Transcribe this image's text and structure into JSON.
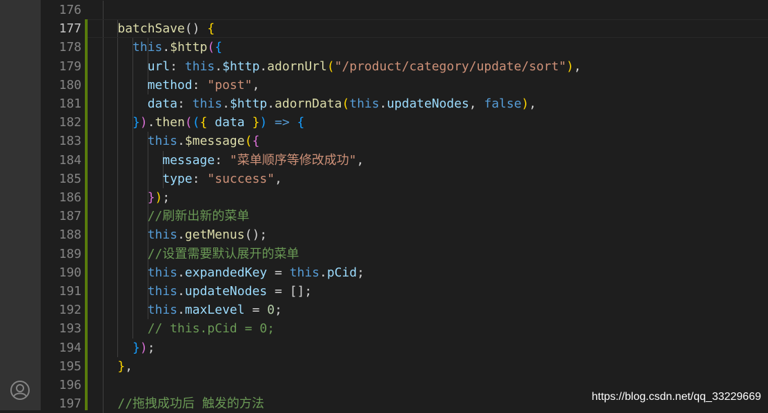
{
  "editor": {
    "lines": [
      {
        "num": "176",
        "segs": []
      },
      {
        "num": "177",
        "segs": [
          [
            "    ",
            "pu"
          ],
          [
            "batchSave",
            "f"
          ],
          [
            "() ",
            "pu"
          ],
          [
            "{",
            "bk"
          ]
        ]
      },
      {
        "num": "178",
        "segs": [
          [
            "      ",
            "pu"
          ],
          [
            "this",
            "k"
          ],
          [
            ".",
            "pu"
          ],
          [
            "$http",
            "f"
          ],
          [
            "(",
            "bk2"
          ],
          [
            "{",
            "bk3"
          ]
        ]
      },
      {
        "num": "179",
        "segs": [
          [
            "        ",
            "pu"
          ],
          [
            "url",
            "p"
          ],
          [
            ": ",
            "pu"
          ],
          [
            "this",
            "k"
          ],
          [
            ".",
            "pu"
          ],
          [
            "$http",
            "p"
          ],
          [
            ".",
            "pu"
          ],
          [
            "adornUrl",
            "f"
          ],
          [
            "(",
            "bk"
          ],
          [
            "\"/product/category/update/sort\"",
            "s"
          ],
          [
            ")",
            "bk"
          ],
          [
            ",",
            "pu"
          ]
        ]
      },
      {
        "num": "180",
        "segs": [
          [
            "        ",
            "pu"
          ],
          [
            "method",
            "p"
          ],
          [
            ": ",
            "pu"
          ],
          [
            "\"post\"",
            "s"
          ],
          [
            ",",
            "pu"
          ]
        ]
      },
      {
        "num": "181",
        "segs": [
          [
            "        ",
            "pu"
          ],
          [
            "data",
            "p"
          ],
          [
            ": ",
            "pu"
          ],
          [
            "this",
            "k"
          ],
          [
            ".",
            "pu"
          ],
          [
            "$http",
            "p"
          ],
          [
            ".",
            "pu"
          ],
          [
            "adornData",
            "f"
          ],
          [
            "(",
            "bk"
          ],
          [
            "this",
            "k"
          ],
          [
            ".",
            "pu"
          ],
          [
            "updateNodes",
            "p"
          ],
          [
            ", ",
            "pu"
          ],
          [
            "false",
            "k"
          ],
          [
            ")",
            "bk"
          ],
          [
            ",",
            "pu"
          ]
        ]
      },
      {
        "num": "182",
        "segs": [
          [
            "      ",
            "pu"
          ],
          [
            "}",
            "bk3"
          ],
          [
            ")",
            "bk2"
          ],
          [
            ".",
            "pu"
          ],
          [
            "then",
            "f"
          ],
          [
            "(",
            "bk2"
          ],
          [
            "(",
            "bk3"
          ],
          [
            "{ ",
            "bk"
          ],
          [
            "data",
            "p"
          ],
          [
            " }",
            "bk"
          ],
          [
            ")",
            "bk3"
          ],
          [
            " => ",
            "k"
          ],
          [
            "{",
            "bk3"
          ]
        ]
      },
      {
        "num": "183",
        "segs": [
          [
            "        ",
            "pu"
          ],
          [
            "this",
            "k"
          ],
          [
            ".",
            "pu"
          ],
          [
            "$message",
            "f"
          ],
          [
            "(",
            "bk"
          ],
          [
            "{",
            "bk2"
          ]
        ]
      },
      {
        "num": "184",
        "segs": [
          [
            "          ",
            "pu"
          ],
          [
            "message",
            "p"
          ],
          [
            ": ",
            "pu"
          ],
          [
            "\"菜单顺序等修改成功\"",
            "s"
          ],
          [
            ",",
            "pu"
          ]
        ]
      },
      {
        "num": "185",
        "segs": [
          [
            "          ",
            "pu"
          ],
          [
            "type",
            "p"
          ],
          [
            ": ",
            "pu"
          ],
          [
            "\"success\"",
            "s"
          ],
          [
            ",",
            "pu"
          ]
        ]
      },
      {
        "num": "186",
        "segs": [
          [
            "        ",
            "pu"
          ],
          [
            "}",
            "bk2"
          ],
          [
            ")",
            "bk"
          ],
          [
            ";",
            "pu"
          ]
        ]
      },
      {
        "num": "187",
        "segs": [
          [
            "        ",
            "pu"
          ],
          [
            "//刷新出新的菜单",
            "c"
          ]
        ]
      },
      {
        "num": "188",
        "segs": [
          [
            "        ",
            "pu"
          ],
          [
            "this",
            "k"
          ],
          [
            ".",
            "pu"
          ],
          [
            "getMenus",
            "f"
          ],
          [
            "();",
            "pu"
          ]
        ]
      },
      {
        "num": "189",
        "segs": [
          [
            "        ",
            "pu"
          ],
          [
            "//设置需要默认展开的菜单",
            "c"
          ]
        ]
      },
      {
        "num": "190",
        "segs": [
          [
            "        ",
            "pu"
          ],
          [
            "this",
            "k"
          ],
          [
            ".",
            "pu"
          ],
          [
            "expandedKey",
            "p"
          ],
          [
            " = ",
            "pu"
          ],
          [
            "this",
            "k"
          ],
          [
            ".",
            "pu"
          ],
          [
            "pCid",
            "p"
          ],
          [
            ";",
            "pu"
          ]
        ]
      },
      {
        "num": "191",
        "segs": [
          [
            "        ",
            "pu"
          ],
          [
            "this",
            "k"
          ],
          [
            ".",
            "pu"
          ],
          [
            "updateNodes",
            "p"
          ],
          [
            " = [];",
            "pu"
          ]
        ]
      },
      {
        "num": "192",
        "segs": [
          [
            "        ",
            "pu"
          ],
          [
            "this",
            "k"
          ],
          [
            ".",
            "pu"
          ],
          [
            "maxLevel",
            "p"
          ],
          [
            " = ",
            "pu"
          ],
          [
            "0",
            "n"
          ],
          [
            ";",
            "pu"
          ]
        ]
      },
      {
        "num": "193",
        "segs": [
          [
            "        ",
            "pu"
          ],
          [
            "// this.pCid = 0;",
            "c"
          ]
        ]
      },
      {
        "num": "194",
        "segs": [
          [
            "      ",
            "pu"
          ],
          [
            "}",
            "bk3"
          ],
          [
            ")",
            "bk2"
          ],
          [
            ";",
            "pu"
          ]
        ]
      },
      {
        "num": "195",
        "segs": [
          [
            "    ",
            "pu"
          ],
          [
            "}",
            "bk"
          ],
          [
            ",",
            "pu"
          ]
        ]
      },
      {
        "num": "196",
        "segs": []
      },
      {
        "num": "197",
        "segs": [
          [
            "    ",
            "pu"
          ],
          [
            "//拖拽成功后 触发的方法",
            "c"
          ]
        ]
      }
    ]
  },
  "watermark": "https://blog.csdn.net/qq_33229669",
  "icons": {
    "account": "account-icon"
  }
}
